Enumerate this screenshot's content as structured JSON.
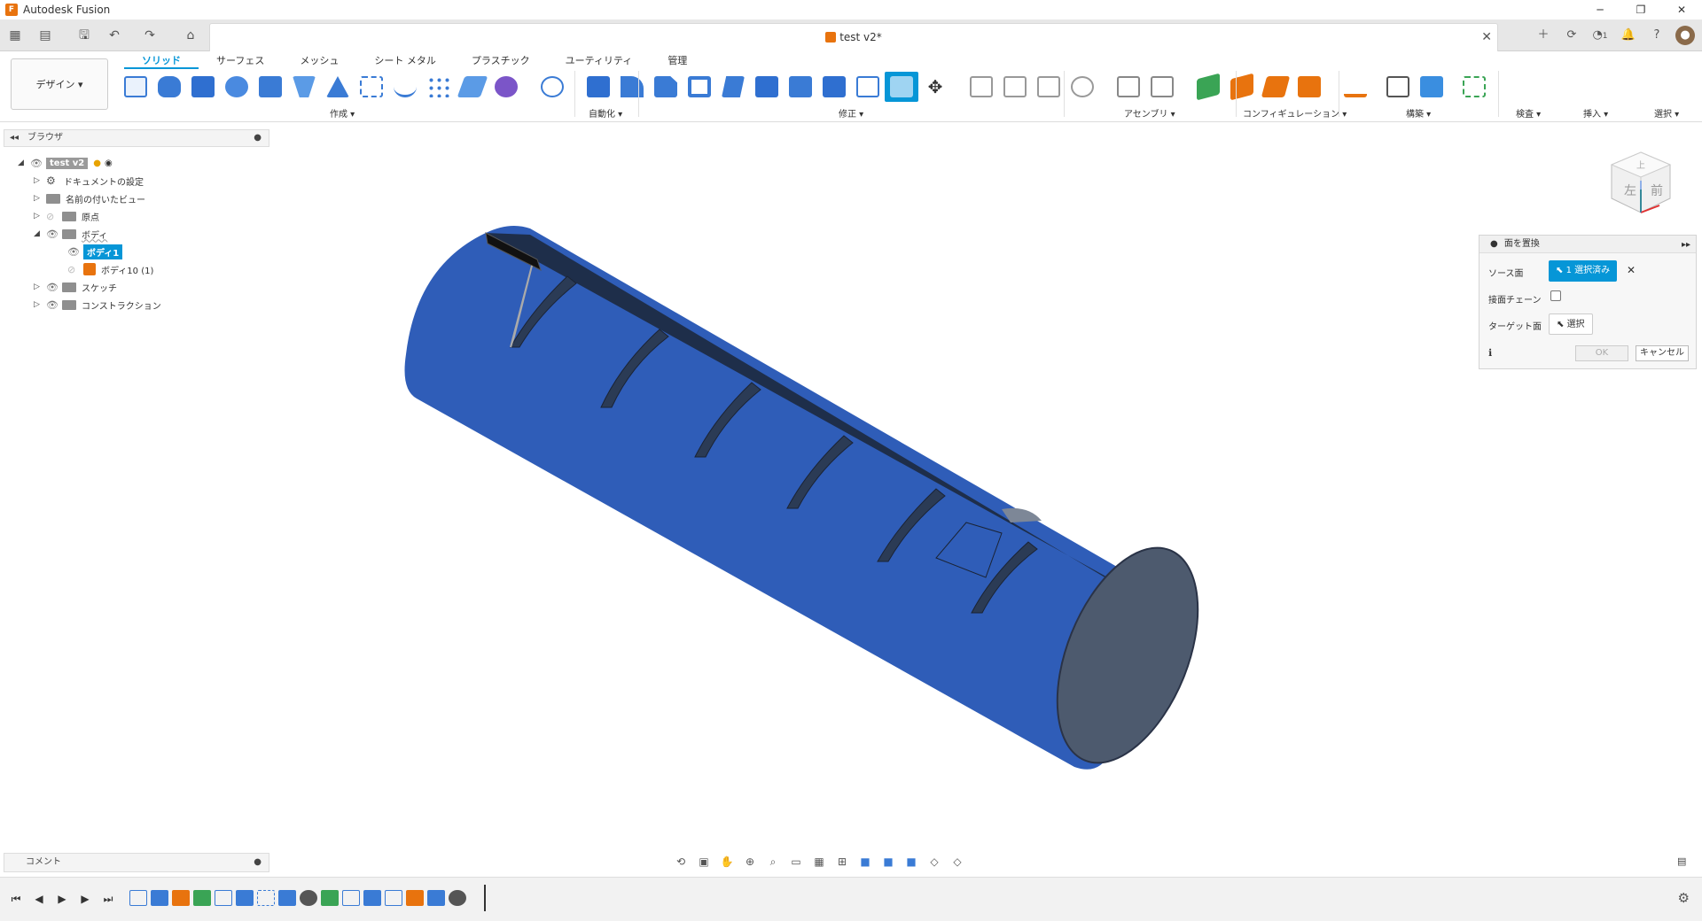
{
  "titlebar": {
    "app_title": "Autodesk Fusion",
    "minimize": "─",
    "maximize": "❐",
    "close": "✕"
  },
  "tabbar": {
    "doc_title": "test v2*",
    "close": "✕",
    "job_count": "1"
  },
  "ribbon": {
    "workspace": "デザイン ▾",
    "tabs": [
      "ソリッド",
      "サーフェス",
      "メッシュ",
      "シート メタル",
      "プラスチック",
      "ユーティリティ",
      "管理"
    ],
    "groups": {
      "create": "作成 ▾",
      "automate": "自動化 ▾",
      "modify": "修正 ▾",
      "assembly": "アセンブリ ▾",
      "configuration": "コンフィギュレーション ▾",
      "construct": "構築 ▾",
      "inspect": "検査 ▾",
      "insert": "挿入 ▾",
      "select": "選択 ▾"
    }
  },
  "browser": {
    "title": "ブラウザ",
    "items": {
      "root": "test v2",
      "doc_settings": "ドキュメントの設定",
      "named_views": "名前の付いたビュー",
      "origin": "原点",
      "bodies": "ボディ",
      "body1": "ボディ1",
      "body10": "ボディ10 (1)",
      "sketches": "スケッチ",
      "construction": "コンストラクション"
    }
  },
  "dialog": {
    "title": "面を置換",
    "source_label": "ソース面",
    "source_value": "1 選択済み",
    "tangent_chain_label": "接面チェーン",
    "target_label": "ターゲット面",
    "target_value": "選択",
    "ok": "OK",
    "cancel": "キャンセル"
  },
  "viewcube": {
    "face_front": "左",
    "face_top": "上",
    "face_right": "前"
  },
  "comment": {
    "label": "コメント"
  },
  "colors": {
    "accent": "#0696d7",
    "body_blue": "#2f5db8",
    "orange": "#e8730e"
  }
}
